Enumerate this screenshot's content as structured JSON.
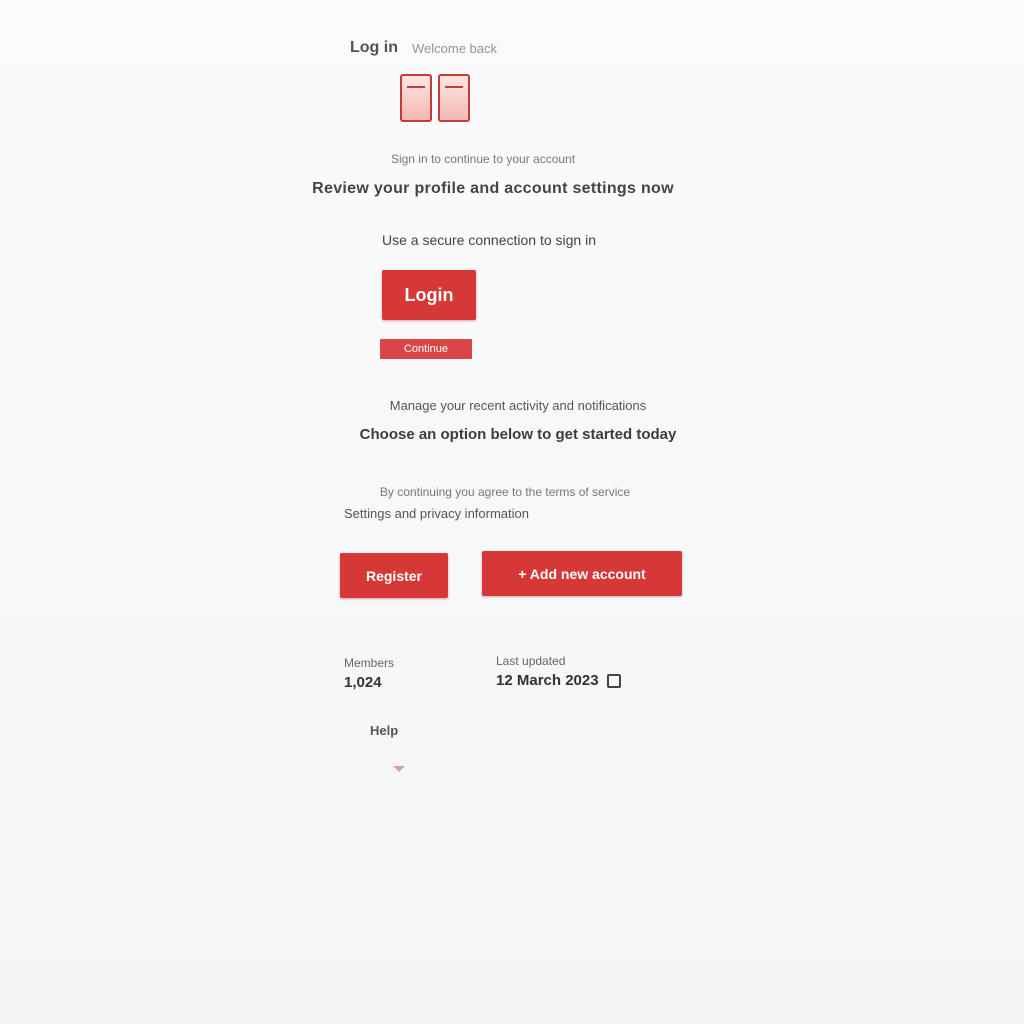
{
  "header": {
    "brand": "Log in",
    "breadcrumb": "Welcome back"
  },
  "intro": {
    "line1": "Sign in to continue to your account",
    "line2": "Review your profile and account settings now",
    "line3": "Use a secure connection to sign in"
  },
  "actions": {
    "primary_label": "Login",
    "tag_label": "Continue"
  },
  "section": {
    "line1": "Manage your recent activity and notifications",
    "line2": "Choose an option below to get started today",
    "line3": "By continuing you agree to the terms of service",
    "line4": "Settings and privacy information"
  },
  "buttons": {
    "secondary_label": "Register",
    "wide_label": "+ Add new account"
  },
  "stats": {
    "left_label": "Members",
    "left_value": "1,024",
    "right_label": "Last updated",
    "right_value": "12 March 2023"
  },
  "footer": {
    "link_label": "Help"
  },
  "colors": {
    "accent": "#d63737",
    "logo_outline": "#c33b3b"
  }
}
